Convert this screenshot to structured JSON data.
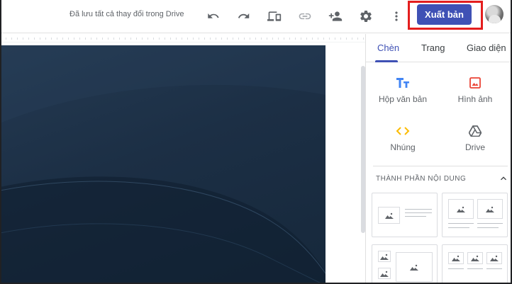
{
  "header": {
    "save_status": "Đã lưu tất cả thay đổi trong Drive",
    "publish_label": "Xuất bản",
    "icons": [
      "undo-icon",
      "redo-icon",
      "preview-devices-icon",
      "link-icon",
      "share-add-person-icon",
      "settings-gear-icon",
      "more-vert-icon"
    ]
  },
  "panel": {
    "tabs": [
      {
        "label": "Chèn"
      },
      {
        "label": "Trang"
      },
      {
        "label": "Giao diện"
      }
    ],
    "insert_items": [
      {
        "label": "Hộp văn bản",
        "icon": "text-box-icon",
        "color": "#4285f4"
      },
      {
        "label": "Hình ảnh",
        "icon": "image-icon",
        "color": "#ea4335"
      },
      {
        "label": "Nhúng",
        "icon": "embed-code-icon",
        "color": "#fbbc04"
      },
      {
        "label": "Drive",
        "icon": "drive-icon",
        "color": "#5f6368"
      }
    ],
    "section_title": "THÀNH PHẦN NỘI DUNG"
  },
  "colors": {
    "accent": "#3f51b5",
    "highlight": "#e41e1e",
    "hero_bg": "#1c2f45"
  }
}
